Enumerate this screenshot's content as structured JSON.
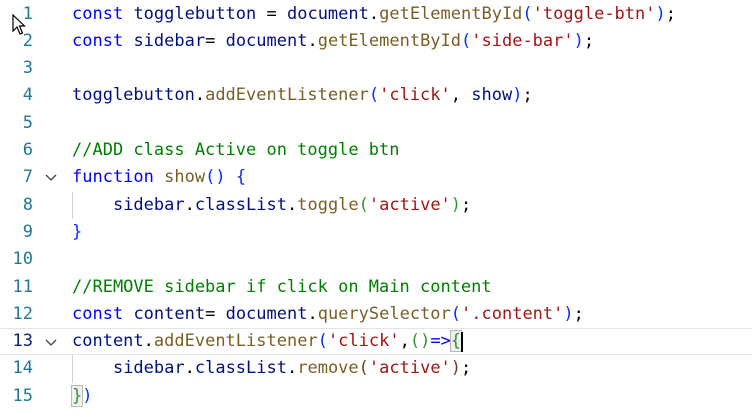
{
  "editor": {
    "lines": [
      {
        "num": "1",
        "tokens": [
          {
            "t": "const",
            "c": "kw"
          },
          {
            "t": " ",
            "c": ""
          },
          {
            "t": "togglebutton",
            "c": "var"
          },
          {
            "t": " = ",
            "c": ""
          },
          {
            "t": "document",
            "c": "var"
          },
          {
            "t": ".",
            "c": ""
          },
          {
            "t": "getElementById",
            "c": "fn"
          },
          {
            "t": "(",
            "c": "b1"
          },
          {
            "t": "'toggle-btn'",
            "c": "str"
          },
          {
            "t": ")",
            "c": "b1"
          },
          {
            "t": ";",
            "c": ""
          }
        ]
      },
      {
        "num": "2",
        "tokens": [
          {
            "t": "const",
            "c": "kw"
          },
          {
            "t": " ",
            "c": ""
          },
          {
            "t": "sidebar",
            "c": "var"
          },
          {
            "t": "= ",
            "c": ""
          },
          {
            "t": "document",
            "c": "var"
          },
          {
            "t": ".",
            "c": ""
          },
          {
            "t": "getElementById",
            "c": "fn"
          },
          {
            "t": "(",
            "c": "b1"
          },
          {
            "t": "'side-bar'",
            "c": "str"
          },
          {
            "t": ")",
            "c": "b1"
          },
          {
            "t": ";",
            "c": ""
          }
        ]
      },
      {
        "num": "3",
        "tokens": []
      },
      {
        "num": "4",
        "tokens": [
          {
            "t": "togglebutton",
            "c": "var"
          },
          {
            "t": ".",
            "c": ""
          },
          {
            "t": "addEventListener",
            "c": "fn"
          },
          {
            "t": "(",
            "c": "b1"
          },
          {
            "t": "'click'",
            "c": "str"
          },
          {
            "t": ", ",
            "c": ""
          },
          {
            "t": "show",
            "c": "var"
          },
          {
            "t": ")",
            "c": "b1"
          },
          {
            "t": ";",
            "c": ""
          }
        ]
      },
      {
        "num": "5",
        "tokens": []
      },
      {
        "num": "6",
        "tokens": [
          {
            "t": "//ADD class Active on toggle btn",
            "c": "cmt"
          }
        ]
      },
      {
        "num": "7",
        "fold": true,
        "tokens": [
          {
            "t": "function",
            "c": "kw"
          },
          {
            "t": " ",
            "c": ""
          },
          {
            "t": "show",
            "c": "fn"
          },
          {
            "t": "()",
            "c": "b1"
          },
          {
            "t": " ",
            "c": ""
          },
          {
            "t": "{",
            "c": "b1"
          }
        ]
      },
      {
        "num": "8",
        "tokens": [
          {
            "t": "    ",
            "c": ""
          },
          {
            "t": "sidebar",
            "c": "var"
          },
          {
            "t": ".",
            "c": ""
          },
          {
            "t": "classList",
            "c": "var"
          },
          {
            "t": ".",
            "c": ""
          },
          {
            "t": "toggle",
            "c": "fn"
          },
          {
            "t": "(",
            "c": "b2"
          },
          {
            "t": "'active'",
            "c": "str"
          },
          {
            "t": ")",
            "c": "b2"
          },
          {
            "t": ";",
            "c": ""
          }
        ]
      },
      {
        "num": "9",
        "tokens": [
          {
            "t": "}",
            "c": "b1"
          }
        ]
      },
      {
        "num": "10",
        "tokens": []
      },
      {
        "num": "11",
        "tokens": [
          {
            "t": "//REMOVE sidebar if click on Main content",
            "c": "cmt"
          }
        ]
      },
      {
        "num": "12",
        "tokens": [
          {
            "t": "const",
            "c": "kw"
          },
          {
            "t": " ",
            "c": ""
          },
          {
            "t": "content",
            "c": "var"
          },
          {
            "t": "= ",
            "c": ""
          },
          {
            "t": "document",
            "c": "var"
          },
          {
            "t": ".",
            "c": ""
          },
          {
            "t": "querySelector",
            "c": "fn"
          },
          {
            "t": "(",
            "c": "b1"
          },
          {
            "t": "'.content'",
            "c": "str"
          },
          {
            "t": ")",
            "c": "b1"
          },
          {
            "t": ";",
            "c": ""
          }
        ]
      },
      {
        "num": "13",
        "fold": true,
        "current": true,
        "tokens": [
          {
            "t": "content",
            "c": "var"
          },
          {
            "t": ".",
            "c": ""
          },
          {
            "t": "addEventListener",
            "c": "fn"
          },
          {
            "t": "(",
            "c": "b1"
          },
          {
            "t": "'click'",
            "c": "str"
          },
          {
            "t": ",",
            "c": ""
          },
          {
            "t": "()",
            "c": "b2"
          },
          {
            "t": "=>",
            "c": "kw"
          },
          {
            "t": "{",
            "c": "b2 hl"
          }
        ]
      },
      {
        "num": "14",
        "tokens": [
          {
            "t": "    ",
            "c": ""
          },
          {
            "t": "sidebar",
            "c": "var"
          },
          {
            "t": ".",
            "c": ""
          },
          {
            "t": "classList",
            "c": "var"
          },
          {
            "t": ".",
            "c": ""
          },
          {
            "t": "remove",
            "c": "fn"
          },
          {
            "t": "(",
            "c": "b3"
          },
          {
            "t": "'active'",
            "c": "str"
          },
          {
            "t": ")",
            "c": "b3"
          },
          {
            "t": ";",
            "c": ""
          }
        ]
      },
      {
        "num": "15",
        "tokens": [
          {
            "t": "}",
            "c": "b2 hl"
          },
          {
            "t": ")",
            "c": "b1"
          }
        ]
      }
    ]
  }
}
